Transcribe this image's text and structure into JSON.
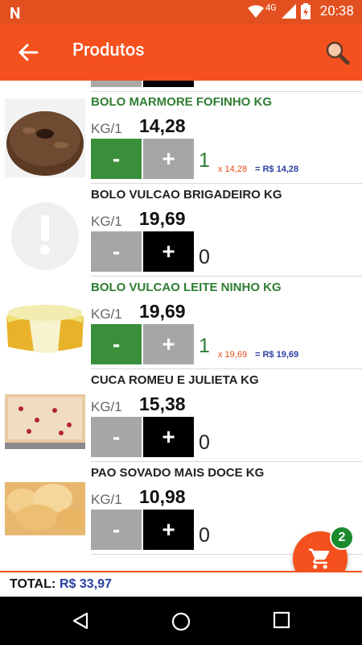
{
  "status_bar": {
    "network": "4G",
    "time": "20:38"
  },
  "app_bar": {
    "title": "Produtos"
  },
  "items": [
    {
      "name": "BOLO MARMORE FOFINHO KG",
      "unit": "KG/1",
      "price": "14,28",
      "minus": "-",
      "plus": "+",
      "qty": "1",
      "selected": true,
      "calc": "x 14,28",
      "total": "= R$ 14,28"
    },
    {
      "name": "BOLO VULCAO BRIGADEIRO KG",
      "unit": "KG/1",
      "price": "19,69",
      "minus": "-",
      "plus": "+",
      "qty": "0",
      "selected": false
    },
    {
      "name": "BOLO VULCAO LEITE NINHO KG",
      "unit": "KG/1",
      "price": "19,69",
      "minus": "-",
      "plus": "+",
      "qty": "1",
      "selected": true,
      "calc": "x 19,69",
      "total": "= R$ 19,69"
    },
    {
      "name": "CUCA ROMEU E JULIETA KG",
      "unit": "KG/1",
      "price": "15,38",
      "minus": "-",
      "plus": "+",
      "qty": "0",
      "selected": false,
      "image_text": "Cuca Romeu e Julieta"
    },
    {
      "name": "PAO SOVADO MAIS DOCE KG",
      "unit": "KG/1",
      "price": "10,98",
      "minus": "-",
      "plus": "+",
      "qty": "0",
      "selected": false,
      "image_text": "Pão Sovado"
    }
  ],
  "cart": {
    "badge": "2"
  },
  "footer": {
    "total_label": "TOTAL:",
    "total_value": "R$ 33,97"
  },
  "colors": {
    "primary": "#f4511e",
    "selected_text": "#2e7d32",
    "selected_button": "#3a8f3a",
    "total_blue": "#2a3fa0"
  }
}
